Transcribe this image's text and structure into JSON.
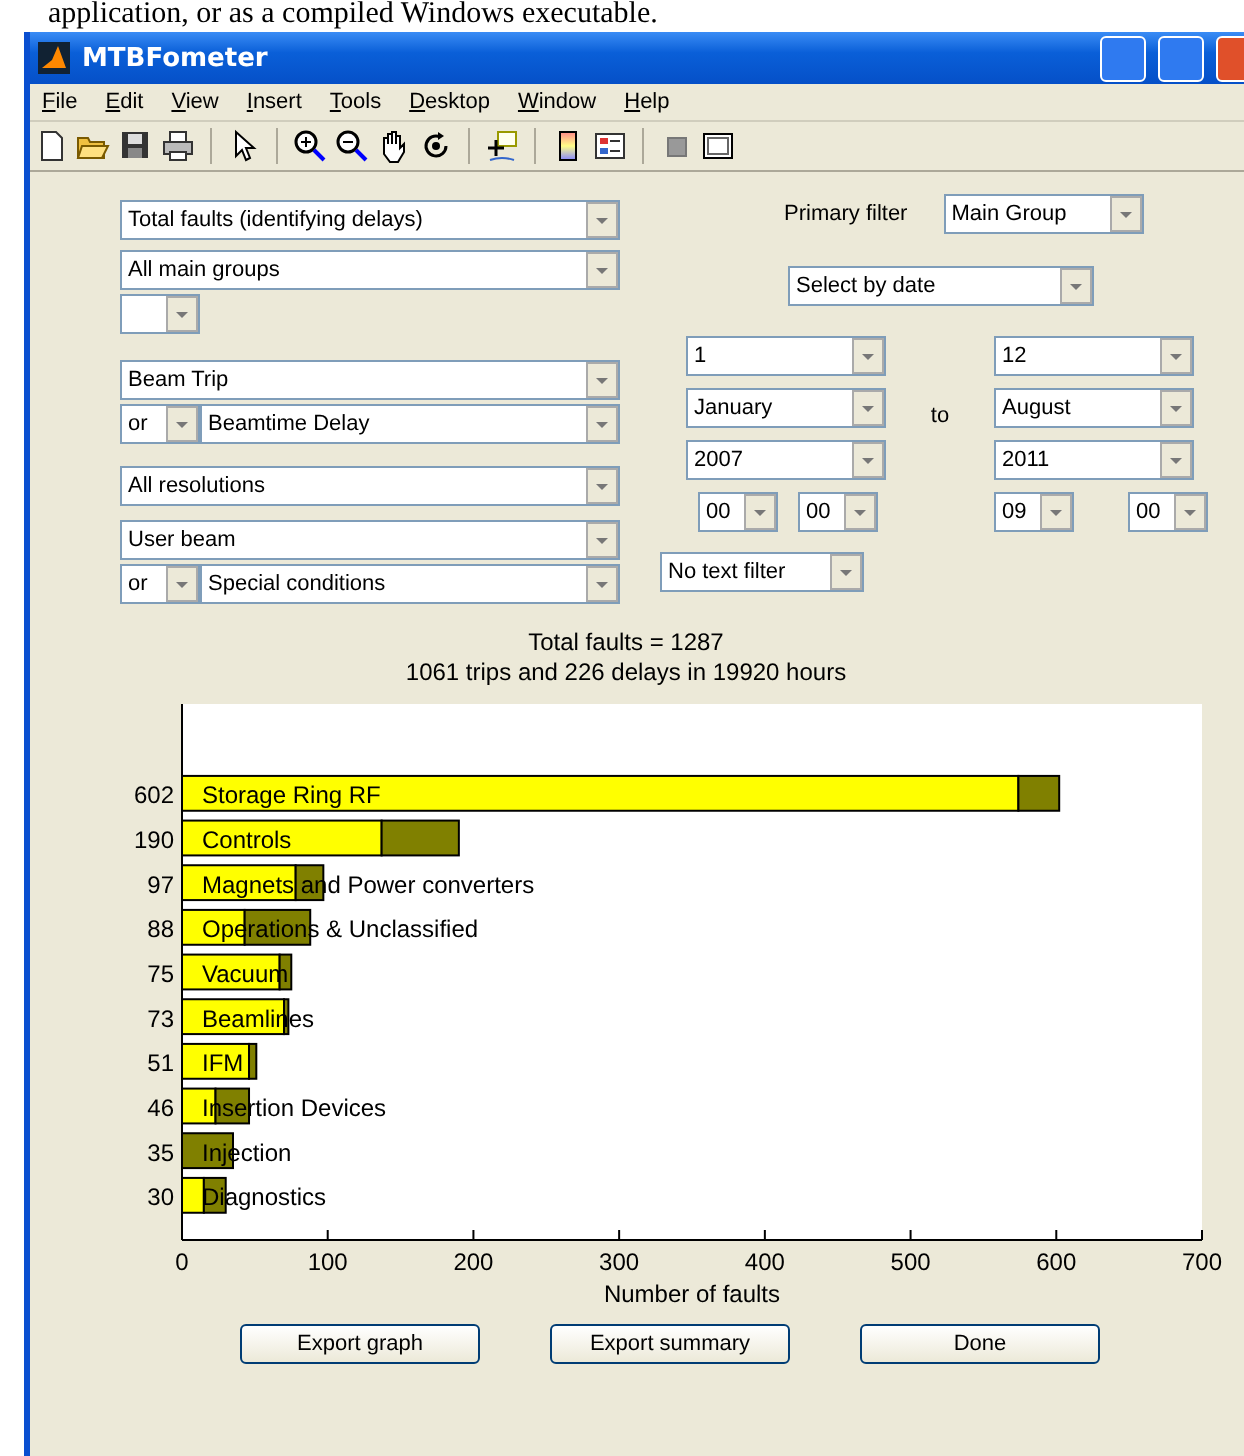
{
  "document_text": "application, or as a compiled Windows executable.",
  "window": {
    "title": "MTBFometer"
  },
  "menu": [
    "File",
    "Edit",
    "View",
    "Insert",
    "Tools",
    "Desktop",
    "Window",
    "Help"
  ],
  "form": {
    "metric": "Total faults (identifying delays)",
    "main_group": "All main groups",
    "fault_type": "Beam Trip",
    "fault_type_2": {
      "operator": "or",
      "value": "Beamtime Delay"
    },
    "resolution": "All resolutions",
    "beam_mode": "User beam",
    "beam_mode_2": {
      "operator": "or",
      "value": "Special conditions"
    },
    "primary_filter": {
      "label": "Primary filter",
      "value": "Main Group"
    },
    "date_mode": "Select by date",
    "from": {
      "day": "1",
      "month": "January",
      "year": "2007",
      "hour": "00",
      "minute": "00"
    },
    "to_label": "to",
    "to": {
      "day": "12",
      "month": "August",
      "year": "2011",
      "hour": "09",
      "minute": "00"
    },
    "text_filter": "No text filter"
  },
  "summary": [
    "Total faults = 1287",
    "1061 trips and 226 delays in 19920 hours"
  ],
  "chart_data": {
    "type": "bar",
    "orientation": "horizontal",
    "stacked": true,
    "xlabel": "Number of faults",
    "xlim": [
      0,
      700
    ],
    "xticks": [
      0,
      100,
      200,
      300,
      400,
      500,
      600,
      700
    ],
    "categories": [
      "Storage Ring RF",
      "Controls",
      "Magnets and Power converters",
      "Operations & Unclassified",
      "Vacuum",
      "Beamlines",
      "IFM",
      "Insertion Devices",
      "Injection",
      "Diagnostics"
    ],
    "value_labels": [
      "602",
      "190",
      "97",
      "88",
      "75",
      "73",
      "51",
      "46",
      "35",
      "30"
    ],
    "series": [
      {
        "color": "#ffff00",
        "values": [
          574,
          137,
          78,
          43,
          67,
          70,
          46,
          23,
          0,
          15
        ]
      },
      {
        "color": "#808000",
        "values": [
          28,
          53,
          19,
          45,
          8,
          3,
          5,
          23,
          35,
          15
        ]
      }
    ]
  },
  "buttons": [
    "Export graph",
    "Export summary",
    "Done"
  ]
}
